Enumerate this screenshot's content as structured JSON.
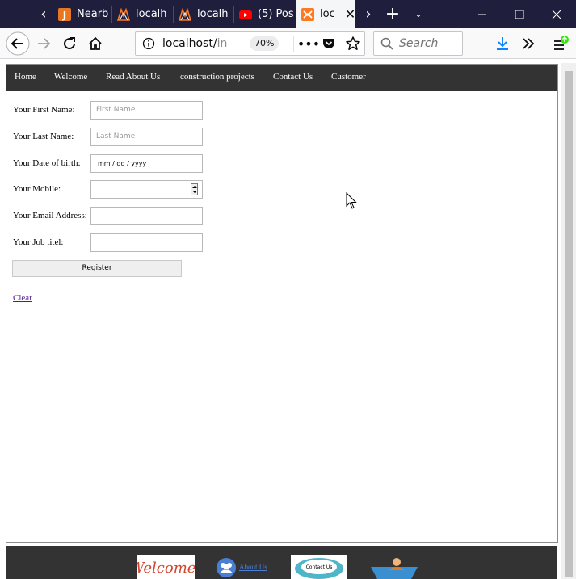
{
  "browser": {
    "tabs": [
      {
        "label": "Nearb",
        "favicon": "j-icon"
      },
      {
        "label": "localh",
        "favicon": "xampp-icon"
      },
      {
        "label": "localh",
        "favicon": "xampp-icon"
      },
      {
        "label": "(5) Pos",
        "favicon": "youtube-icon"
      },
      {
        "label": "loc",
        "favicon": "xampp-icon",
        "active": true
      }
    ],
    "url_host": "localhost/",
    "url_rest": "in",
    "zoom": "70%",
    "search_placeholder": "Search"
  },
  "menu": {
    "items": [
      "Home",
      "Welcome",
      "Read About Us",
      "construction projects",
      "Contact Us",
      "Customer"
    ]
  },
  "form": {
    "first_name_label": "Your First Name:",
    "first_name_placeholder": "First Name",
    "last_name_label": "Your Last Name:",
    "last_name_placeholder": "Last Name",
    "dob_label": "Your Date of birth:",
    "dob_placeholder": "mm / dd / yyyy",
    "mobile_label": "Your Mobile:",
    "email_label": "Your Email Address:",
    "job_label": "Your Job titel:",
    "register_label": "Register",
    "clear_label": "Clear"
  },
  "footer": {
    "about_label": "About Us",
    "welcome_logo_text": "Welcome!",
    "contact_logo_text": "Contact Us"
  },
  "colors": {
    "titlebar": "#1f1e3d",
    "menu_bg": "#333333",
    "link_visited": "#551a8b",
    "accent_download": "#0a84ff"
  }
}
